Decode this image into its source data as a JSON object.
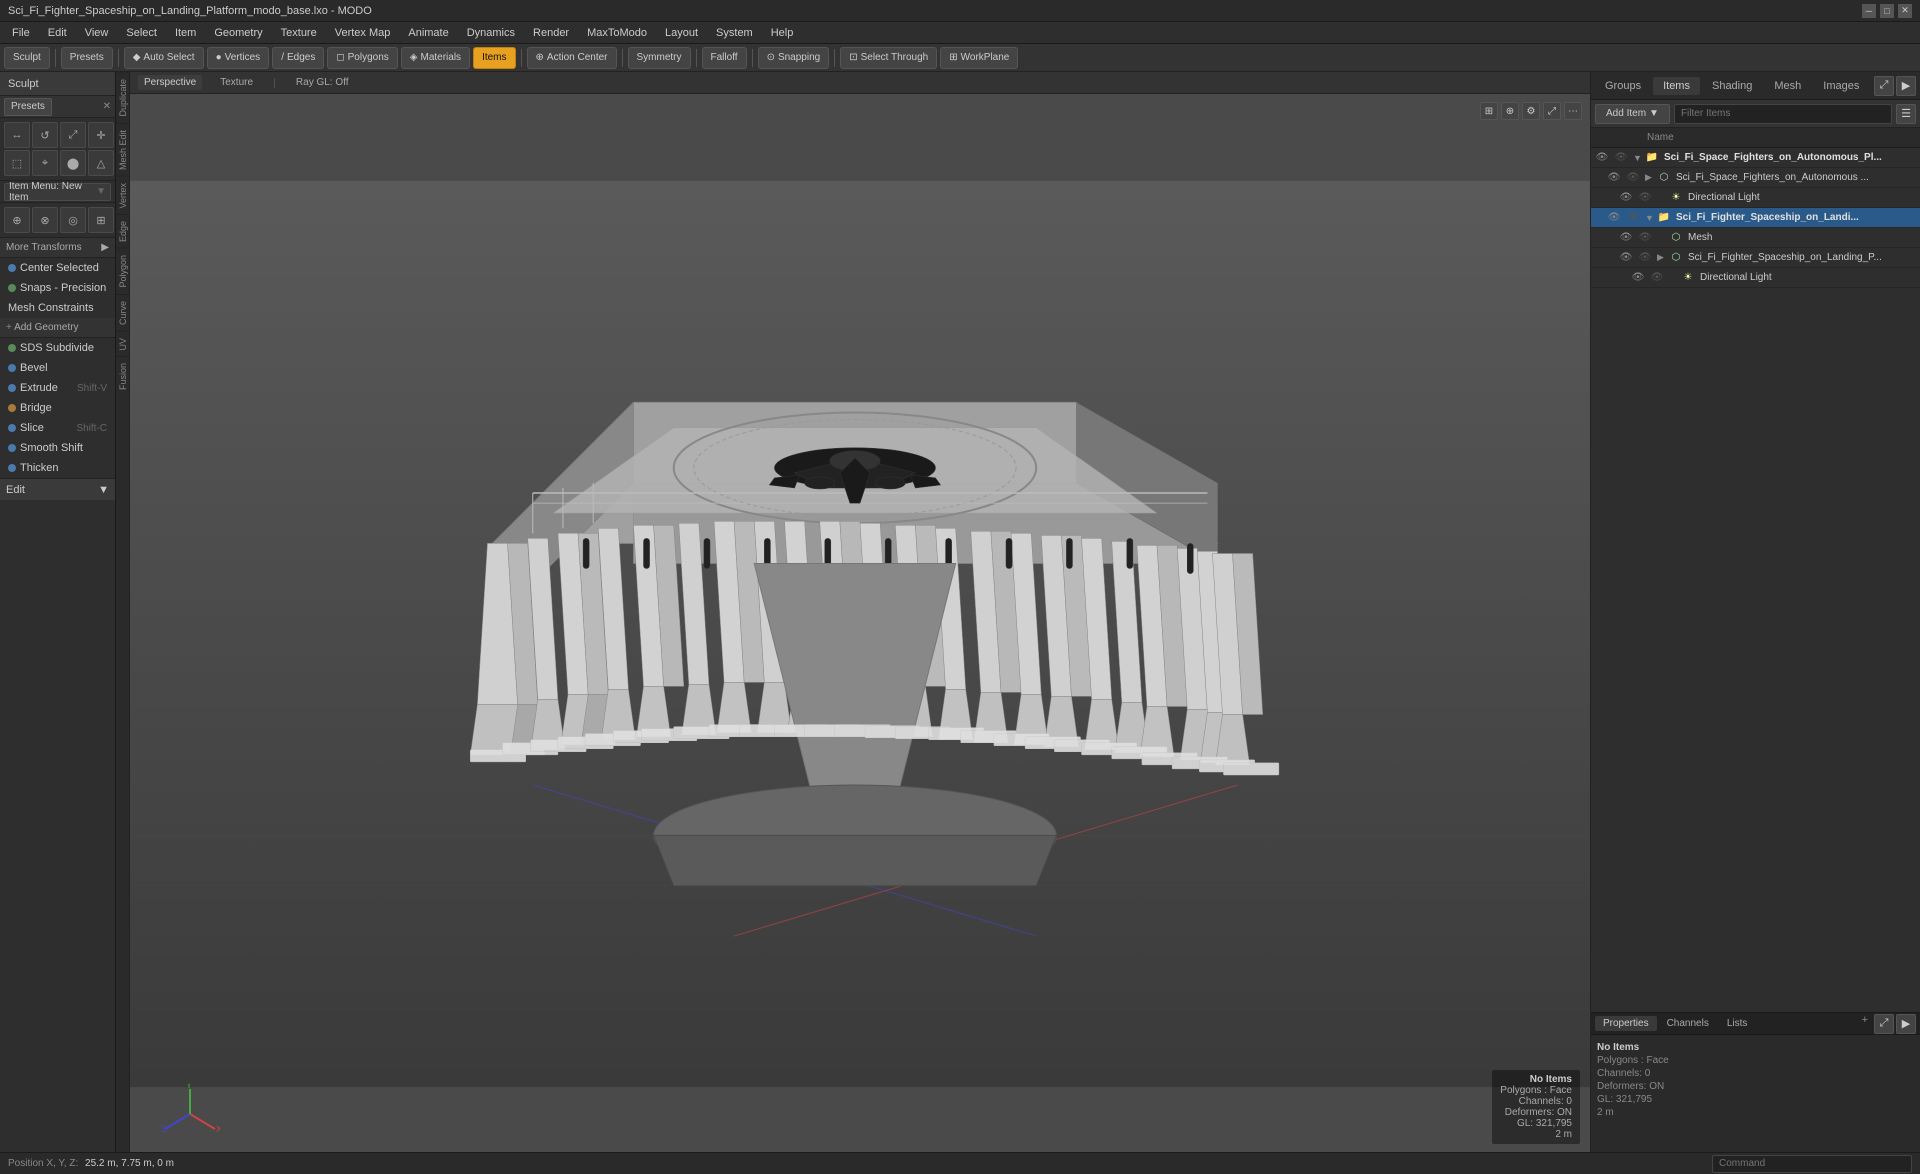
{
  "titleBar": {
    "title": "Sci_Fi_Fighter_Spaceship_on_Landing_Platform_modo_base.lxo - MODO",
    "controls": [
      "minimize",
      "maximize",
      "close"
    ]
  },
  "menuBar": {
    "items": [
      "File",
      "Edit",
      "View",
      "Select",
      "Item",
      "Geometry",
      "Texture",
      "Vertex Map",
      "Animate",
      "Dynamics",
      "Render",
      "MaxToModo",
      "Layout",
      "System",
      "Help"
    ]
  },
  "toolbar": {
    "sculpt_label": "Sculpt",
    "presets_label": "Presets",
    "auto_select_label": "Auto Select",
    "vertices_label": "Vertices",
    "edges_label": "Edges",
    "polygons_label": "Polygons",
    "materials_label": "Materials",
    "items_label": "Items",
    "action_center_label": "Action Center",
    "symmetry_label": "Symmetry",
    "falloff_label": "Falloff",
    "snapping_label": "Snapping",
    "select_through_label": "Select Through",
    "workplane_label": "WorkPlane"
  },
  "leftPanel": {
    "sculpt_label": "Sculpt",
    "presets_label": "Presets",
    "item_menu_label": "Item Menu: New Item",
    "more_transforms_label": "More Transforms",
    "center_selected_label": "Center Selected",
    "snaps_precision_label": "Snaps - Precision",
    "snaps_precision_shortcut": "",
    "mesh_constraints_label": "Mesh Constraints",
    "add_geometry_label": "Add Geometry",
    "sds_subdivide_label": "SDS Subdivide",
    "bevel_label": "Bevel",
    "extrude_label": "Extrude",
    "extrude_shortcut": "Shift-V",
    "bridge_label": "Bridge",
    "slice_label": "Slice",
    "slice_shortcut": "Shift-C",
    "smooth_shift_label": "Smooth Shift",
    "thicken_label": "Thicken",
    "edit_label": "Edit",
    "sideTabs": [
      "Duplicate",
      "Mesh Edit",
      "Vertex",
      "Edge",
      "Polygon",
      "Curve",
      "UV",
      "Fusion"
    ]
  },
  "viewport": {
    "perspective_label": "Perspective",
    "texture_label": "Texture",
    "ray_gl_label": "Ray GL: Off"
  },
  "rightPanel": {
    "tabs": [
      "Groups",
      "Items",
      "Shading",
      "Mesh",
      "Images"
    ],
    "active_tab": "Items",
    "add_item_label": "Add Item",
    "filter_placeholder": "Filter Items",
    "name_col": "Name",
    "items_tree": [
      {
        "label": "Sci_Fi_Space_Fighters_on_Autonomous_Pl...",
        "indent": 0,
        "expanded": true,
        "type": "group",
        "children": [
          {
            "label": "Sci_Fi_Space_Fighters_on_Autonomous ...",
            "indent": 1,
            "type": "mesh",
            "children": [
              {
                "label": "Directional Light",
                "indent": 2,
                "type": "light"
              }
            ]
          },
          {
            "label": "Sci_Fi_Fighter_Spaceship_on_Landi...",
            "indent": 1,
            "expanded": true,
            "type": "group",
            "selected": true,
            "children": [
              {
                "label": "Mesh",
                "indent": 2,
                "type": "mesh"
              },
              {
                "label": "Sci_Fi_Fighter_Spaceship_on_Landing_P...",
                "indent": 2,
                "type": "mesh"
              },
              {
                "label": "Directional Light",
                "indent": 3,
                "type": "light"
              }
            ]
          }
        ]
      }
    ],
    "properties": {
      "tabs": [
        "Properties",
        "Channels",
        "Lists"
      ],
      "active_tab": "Properties",
      "no_items_label": "No Items",
      "polygons_label": "Polygons : Face",
      "channels_label": "Channels: 0",
      "deformers_label": "Deformers: ON",
      "gl_label": "GL: 321,795",
      "unit_label": "2 m"
    }
  },
  "statusBar": {
    "position_label": "Position X, Y, Z:",
    "position_value": "25.2 m, 7.75 m, 0 m",
    "command_placeholder": "Command"
  }
}
